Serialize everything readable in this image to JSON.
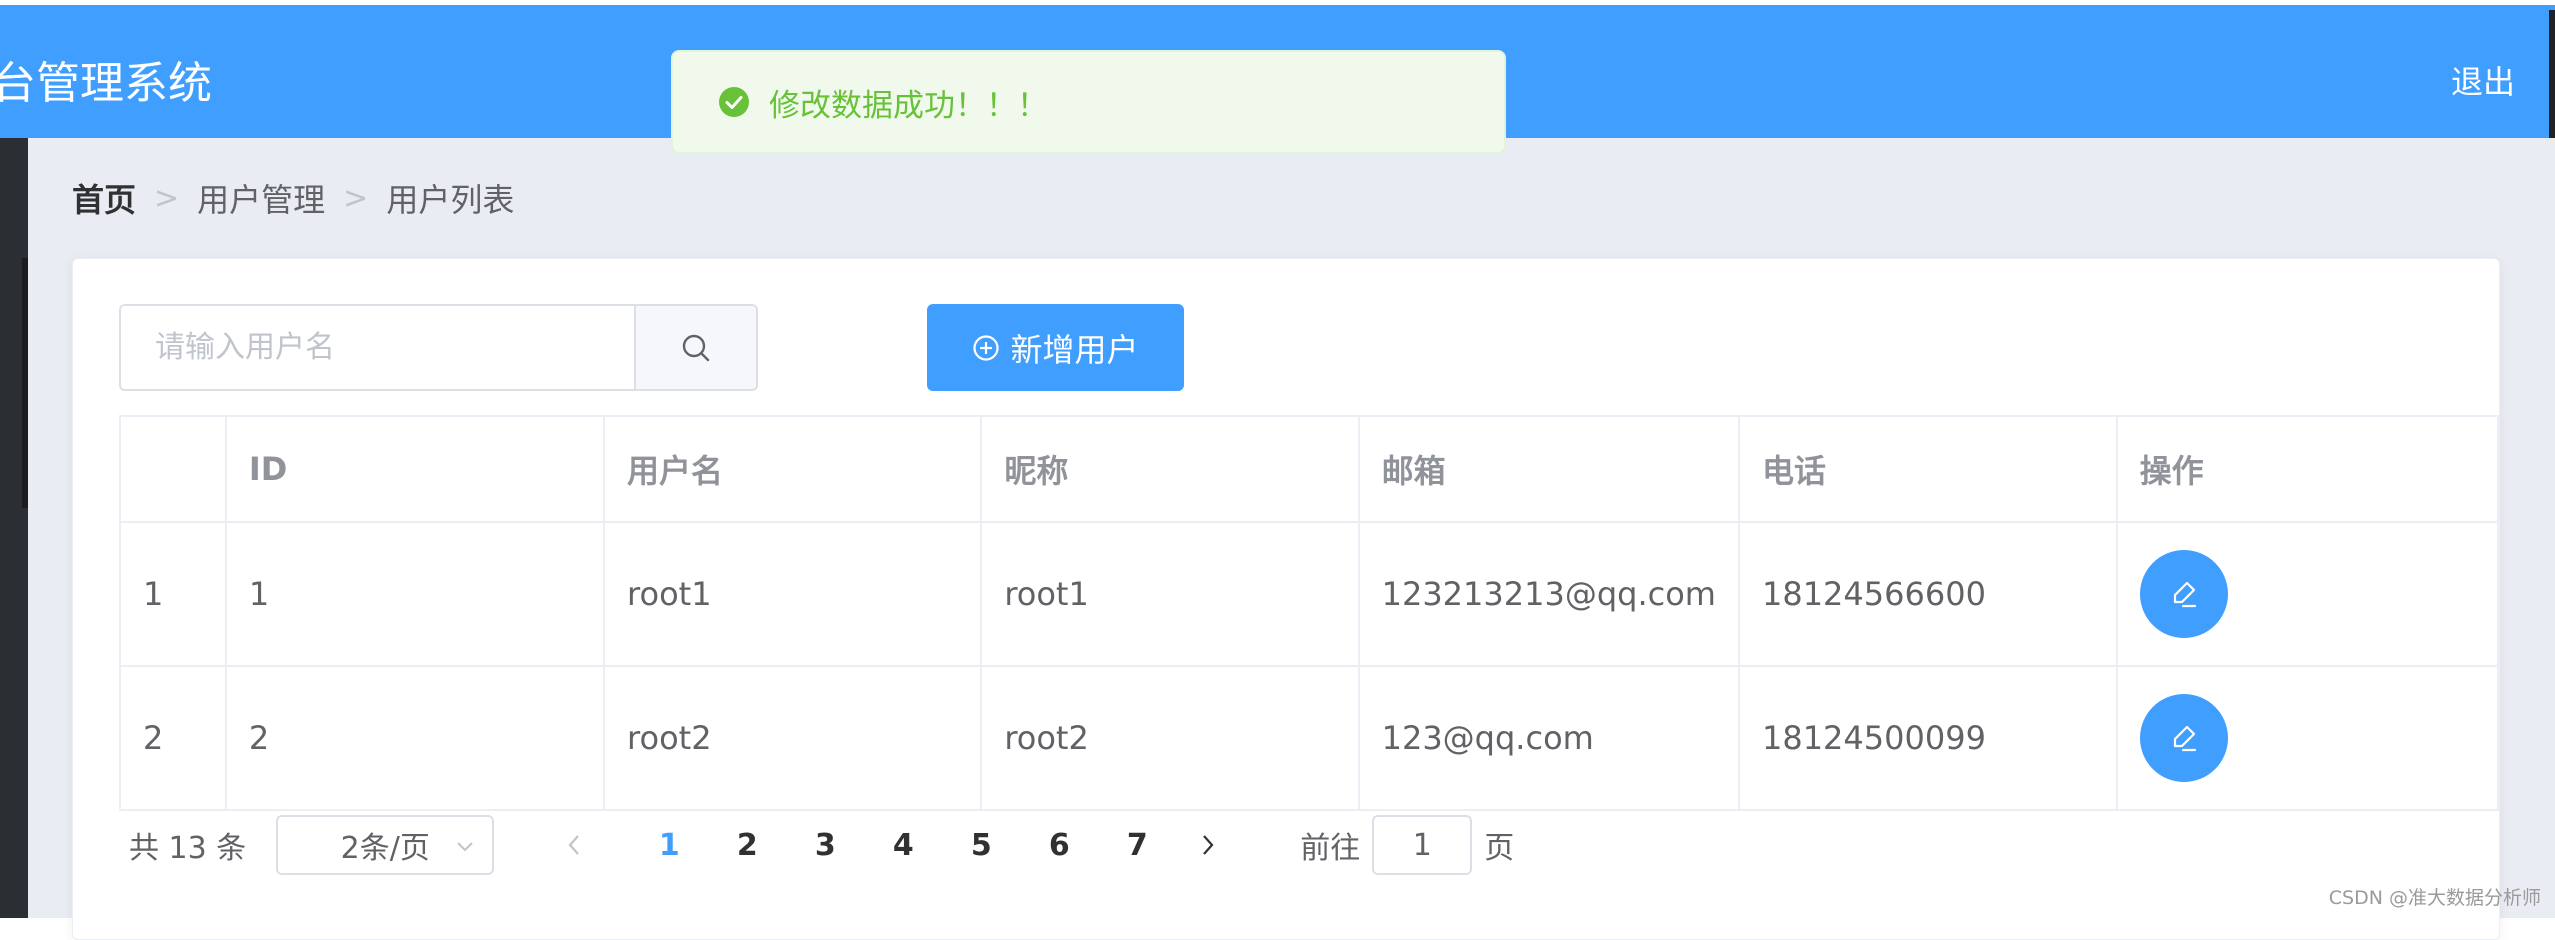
{
  "header": {
    "title": "台管理系统",
    "logout_label": "退出"
  },
  "toast": {
    "message": "修改数据成功！！！",
    "icon": "success-check-icon"
  },
  "breadcrumb": {
    "items": [
      "首页",
      "用户管理",
      "用户列表"
    ]
  },
  "toolbar": {
    "search_placeholder": "请输入用户名",
    "search_value": "",
    "add_label": "新增用户"
  },
  "table": {
    "columns": [
      "",
      "ID",
      "用户名",
      "昵称",
      "邮箱",
      "电话",
      "操作"
    ],
    "rows": [
      {
        "index": "1",
        "id": "1",
        "username": "root1",
        "nickname": "root1",
        "email": "123213213@qq.com",
        "phone": "18124566600"
      },
      {
        "index": "2",
        "id": "2",
        "username": "root2",
        "nickname": "root2",
        "email": "123@qq.com",
        "phone": "18124500099"
      }
    ]
  },
  "pagination": {
    "total_label": "共 13 条",
    "page_size_label": "2条/页",
    "pages": [
      "1",
      "2",
      "3",
      "4",
      "5",
      "6",
      "7"
    ],
    "current_page": "1",
    "goto_prefix": "前往",
    "goto_value": "1",
    "goto_suffix": "页"
  },
  "watermark": "CSDN @准大数据分析师",
  "colors": {
    "primary": "#409eff",
    "success": "#67c23a",
    "success_bg": "#f0f9eb",
    "sidebar": "#2b2f33",
    "page_bg": "#e9edf3"
  }
}
